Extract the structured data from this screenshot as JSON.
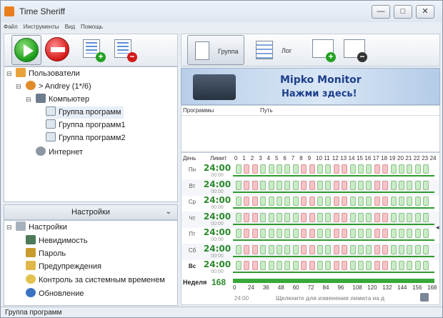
{
  "window": {
    "title": "Time Sheriff",
    "min_glyph": "—",
    "max_glyph": "□",
    "close_glyph": "✕"
  },
  "menu": [
    "Файл",
    "Инструменты",
    "Вид",
    "Помощь"
  ],
  "right_toolbar": {
    "group_label": "Группа",
    "log_label": "Лог"
  },
  "tree": {
    "users": "Пользователи",
    "user": "> Andrey (1*/6)",
    "computer": "Компьютер",
    "groups": [
      "Группа программ",
      "Группа программ1",
      "Группа программ2"
    ],
    "internet": "Интернет"
  },
  "settings": {
    "header": "Настройки",
    "root": "Настройки",
    "items": [
      "Невидимость",
      "Пароль",
      "Предупреждения",
      "Контроль за системным временем",
      "Обновление"
    ]
  },
  "banner": {
    "line1": "Mipko Monitor",
    "line2": "Нажми здесь!"
  },
  "programs": {
    "col_programs": "Программы",
    "col_path": "Путь"
  },
  "schedule": {
    "col_day": "День",
    "col_limit": "Лимит",
    "hours": [
      "0",
      "1",
      "2",
      "3",
      "4",
      "5",
      "6",
      "7",
      "8",
      "9",
      "10",
      "11",
      "12",
      "13",
      "14",
      "15",
      "16",
      "17",
      "18",
      "19",
      "20",
      "21",
      "22",
      "23",
      "24"
    ],
    "limit_sub": "00:00",
    "days": [
      {
        "name": "Пн",
        "limit": "24:00"
      },
      {
        "name": "Вт",
        "limit": "24:00"
      },
      {
        "name": "Ср",
        "limit": "24:00"
      },
      {
        "name": "Чт",
        "limit": "24:00"
      },
      {
        "name": "Пт",
        "limit": "24:00"
      },
      {
        "name": "Сб",
        "limit": "24:00"
      },
      {
        "name": "Вс",
        "limit": "24:00"
      }
    ],
    "blocked_hours": [
      1,
      2,
      8,
      9,
      12,
      13,
      17,
      18
    ],
    "week_label": "Неделя",
    "week_limit": "168",
    "week_ticks": [
      "0",
      "24",
      "36",
      "48",
      "60",
      "72",
      "84",
      "96",
      "108",
      "120",
      "132",
      "144",
      "156",
      "168"
    ],
    "footer_time": "24:00",
    "footer_hint": "Щелкните для изменения лимита на д"
  },
  "status": "Группа программ"
}
